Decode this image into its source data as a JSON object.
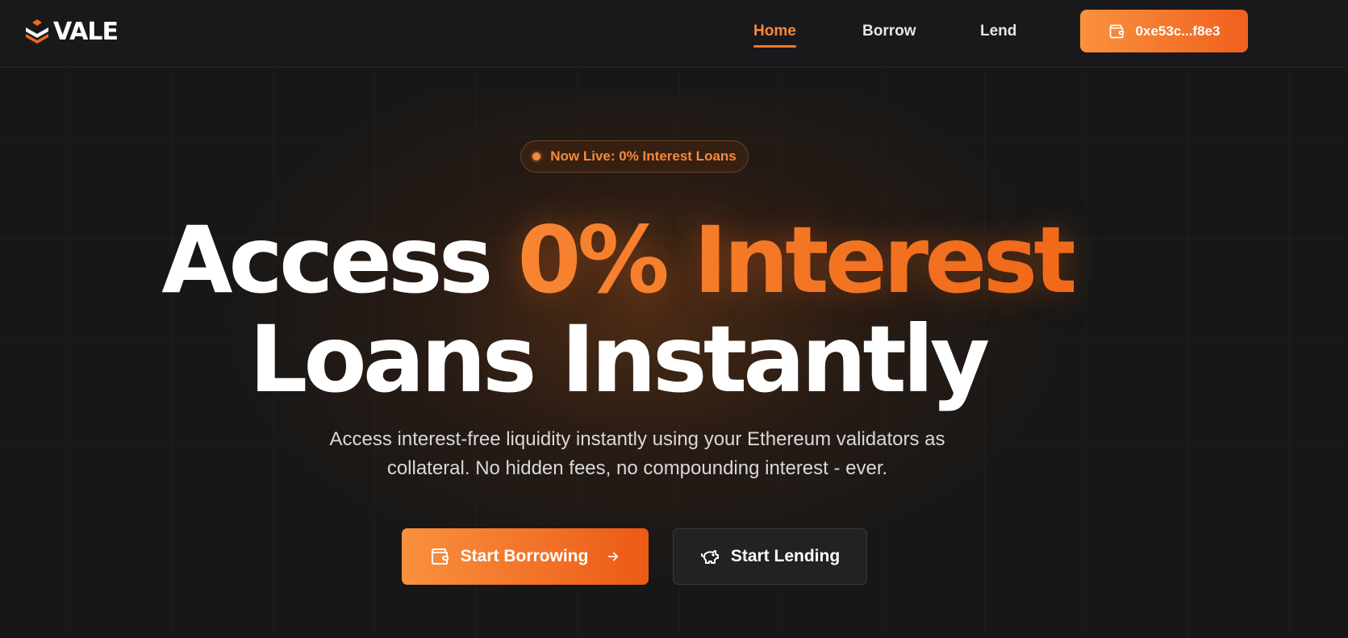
{
  "brand": {
    "name": "VALE",
    "logo_icon": "layers-logo-icon"
  },
  "nav": {
    "items": [
      {
        "label": "Home",
        "active": true
      },
      {
        "label": "Borrow",
        "active": false
      },
      {
        "label": "Lend",
        "active": false
      }
    ]
  },
  "wallet": {
    "address": "0xe53c...f8e3",
    "icon": "wallet-icon"
  },
  "hero": {
    "badge": "Now Live: 0% Interest Loans",
    "headline_part1": "Access ",
    "headline_accent": "0% Interest",
    "headline_line2": "Loans Instantly",
    "subtitle_line1": "Access interest-free liquidity instantly using your Ethereum validators as",
    "subtitle_line2": "collateral. No hidden fees, no compounding interest - ever.",
    "cta_primary": {
      "label": "Start Borrowing",
      "icon": "wallet-icon",
      "trailing_icon": "arrow-right-icon"
    },
    "cta_secondary": {
      "label": "Start Lending",
      "icon": "piggy-bank-icon"
    }
  },
  "colors": {
    "accent": "#f47a2a",
    "accent_gradient_start": "#f9913f",
    "accent_gradient_end": "#ec5a15",
    "background": "#171717",
    "header_bg": "#19191b"
  }
}
